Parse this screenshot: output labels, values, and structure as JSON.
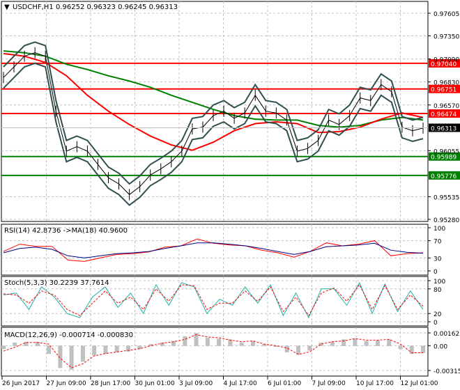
{
  "header": {
    "symbol": "USDCHF,H1",
    "ohlc": "0.96252 0.96323 0.96245 0.96313",
    "menu_icon": "triangle-down-icon"
  },
  "colors": {
    "support": "#008000",
    "resistance": "#ff0000",
    "price": "#000000",
    "bands": "#2f4f4f",
    "ma_fast": "#ff0000",
    "ma_slow": "#008000",
    "rsi": "#ff0000",
    "rsi_ma": "#000080",
    "stoch_main": "#20b2aa",
    "stoch_signal": "#ff0000",
    "macd_hist": "#c0c0c0",
    "macd_signal": "#ff0000"
  },
  "chart_data": [
    {
      "type": "line",
      "title": "USDCHF,H1",
      "ylim": [
        0.9528,
        0.97605
      ],
      "y_ticks": [
        "0.97605",
        "0.97350",
        "0.97090",
        "0.96830",
        "0.96570",
        "0.96055",
        "0.95535",
        "0.95280"
      ],
      "x_ticks": [
        "26 Jun 2017",
        "27 Jun 09:00",
        "28 Jun 17:00",
        "30 Jun 01:00",
        "3 Jul 09:00",
        "4 Jul 17:00",
        "6 Jul 01:00",
        "7 Jul 09:00",
        "10 Jul 17:00",
        "12 Jul 01:00"
      ],
      "grid": true,
      "levels": [
        {
          "value": 0.9704,
          "label": "0.97040",
          "kind": "resistance"
        },
        {
          "value": 0.96751,
          "label": "0.96751",
          "kind": "resistance"
        },
        {
          "value": 0.96474,
          "label": "0.96474",
          "kind": "resistance"
        },
        {
          "value": 0.95989,
          "label": "0.95989",
          "kind": "support"
        },
        {
          "value": 0.95776,
          "label": "0.95776",
          "kind": "support"
        }
      ],
      "current_price": {
        "value": 0.96313,
        "label": "0.96313"
      },
      "series": [
        {
          "values": [
            0.9688,
            0.97,
            0.9712,
            0.9716,
            0.9712,
            0.965,
            0.9605,
            0.961,
            0.9605,
            0.959,
            0.9575,
            0.9568,
            0.9556,
            0.9565,
            0.9578,
            0.9585,
            0.9593,
            0.9605,
            0.963,
            0.9632,
            0.9645,
            0.965,
            0.9642,
            0.9648,
            0.9668,
            0.965,
            0.9648,
            0.964,
            0.9605,
            0.9608,
            0.9617,
            0.964,
            0.9635,
            0.9645,
            0.9665,
            0.9662,
            0.968,
            0.9672,
            0.9632,
            0.9628,
            0.9631
          ]
        },
        {
          "values": [
            0.9715,
            0.9712,
            0.9705,
            0.969,
            0.9668,
            0.965,
            0.9635,
            0.9622,
            0.9612,
            0.9606,
            0.9615,
            0.9628,
            0.9636,
            0.9638,
            0.9636,
            0.9626,
            0.9627,
            0.9632,
            0.9641,
            0.9648,
            0.9643
          ]
        },
        {
          "values": [
            0.9718,
            0.9716,
            0.9712,
            0.9703,
            0.9697,
            0.969,
            0.9684,
            0.9677,
            0.9668,
            0.966,
            0.9652,
            0.9645,
            0.9641,
            0.964,
            0.964,
            0.9634,
            0.9632,
            0.9634,
            0.964,
            0.9643,
            0.964
          ]
        }
      ]
    },
    {
      "type": "line",
      "title": "RSI(14) 42.8736  ->MA(18) 40.9600",
      "ylim": [
        0,
        100
      ],
      "y_ticks": [
        "100",
        "70",
        "30",
        "0"
      ],
      "series": [
        {
          "values": [
            45,
            62,
            57,
            57,
            25,
            22,
            30,
            38,
            40,
            44,
            55,
            58,
            74,
            64,
            60,
            58,
            48,
            42,
            32,
            45,
            65,
            58,
            62,
            70,
            35,
            40,
            42
          ]
        },
        {
          "values": [
            42,
            52,
            55,
            50,
            35,
            30,
            35,
            40,
            42,
            45,
            52,
            58,
            65,
            65,
            62,
            58,
            52,
            45,
            38,
            45,
            56,
            58,
            60,
            64,
            48,
            43,
            41
          ]
        }
      ]
    },
    {
      "type": "line",
      "title": "Stoch(5,3,3) 30.2239 37.7614",
      "ylim": [
        0,
        100
      ],
      "y_ticks": [
        "100",
        "80",
        "20",
        "0"
      ],
      "series": [
        {
          "values": [
            65,
            70,
            30,
            85,
            60,
            20,
            10,
            60,
            85,
            35,
            70,
            20,
            90,
            40,
            95,
            85,
            20,
            55,
            40,
            85,
            45,
            90,
            15,
            70,
            10,
            80,
            80,
            40,
            95,
            20,
            92,
            25,
            75,
            30
          ]
        },
        {
          "values": [
            68,
            65,
            45,
            75,
            65,
            30,
            15,
            45,
            75,
            45,
            60,
            30,
            80,
            50,
            90,
            88,
            30,
            45,
            45,
            75,
            50,
            85,
            25,
            60,
            15,
            70,
            82,
            50,
            90,
            30,
            88,
            30,
            65,
            38
          ]
        }
      ]
    },
    {
      "type": "bar",
      "title": "MACD(12,26,9) -0.000714 -0.000830",
      "ylim": [
        -0.003157,
        0.001622
      ],
      "y_ticks": [
        "0.001622",
        "0.00",
        "-0.003157"
      ],
      "series": [
        {
          "values": [
            -0.0004,
            0.0004,
            0.0005,
            0.0005,
            -0.001,
            -0.0028,
            -0.003,
            -0.002,
            -0.0012,
            -0.001,
            -0.0008,
            -0.0007,
            -0.0004,
            0.0002,
            0.0004,
            0.0006,
            0.0012,
            0.0016,
            0.001,
            0.0009,
            0.0008,
            0.0004,
            0.0006,
            0.0002,
            -0.0001,
            -0.0008,
            -0.0011,
            -0.0006,
            0.0004,
            0.0005,
            0.0008,
            0.0009,
            0.0006,
            0.0007,
            0.0008,
            -0.0004,
            -0.001,
            -0.0009
          ]
        },
        {
          "values": [
            -0.0007,
            -0.0002,
            0.0004,
            0.0004,
            0.0002,
            -0.0016,
            -0.0028,
            -0.0023,
            -0.0013,
            -0.001,
            -0.0008,
            -0.0006,
            -0.0004,
            0.0,
            0.0003,
            0.0005,
            0.0008,
            0.0014,
            0.0011,
            0.001,
            0.0007,
            0.0005,
            0.0006,
            0.0002,
            0.0,
            -0.0003,
            -0.0011,
            -0.0008,
            0.0002,
            0.0005,
            0.0006,
            0.0009,
            0.0007,
            0.0007,
            0.0008,
            0.0002,
            -0.0009,
            -0.0009
          ]
        }
      ]
    }
  ]
}
